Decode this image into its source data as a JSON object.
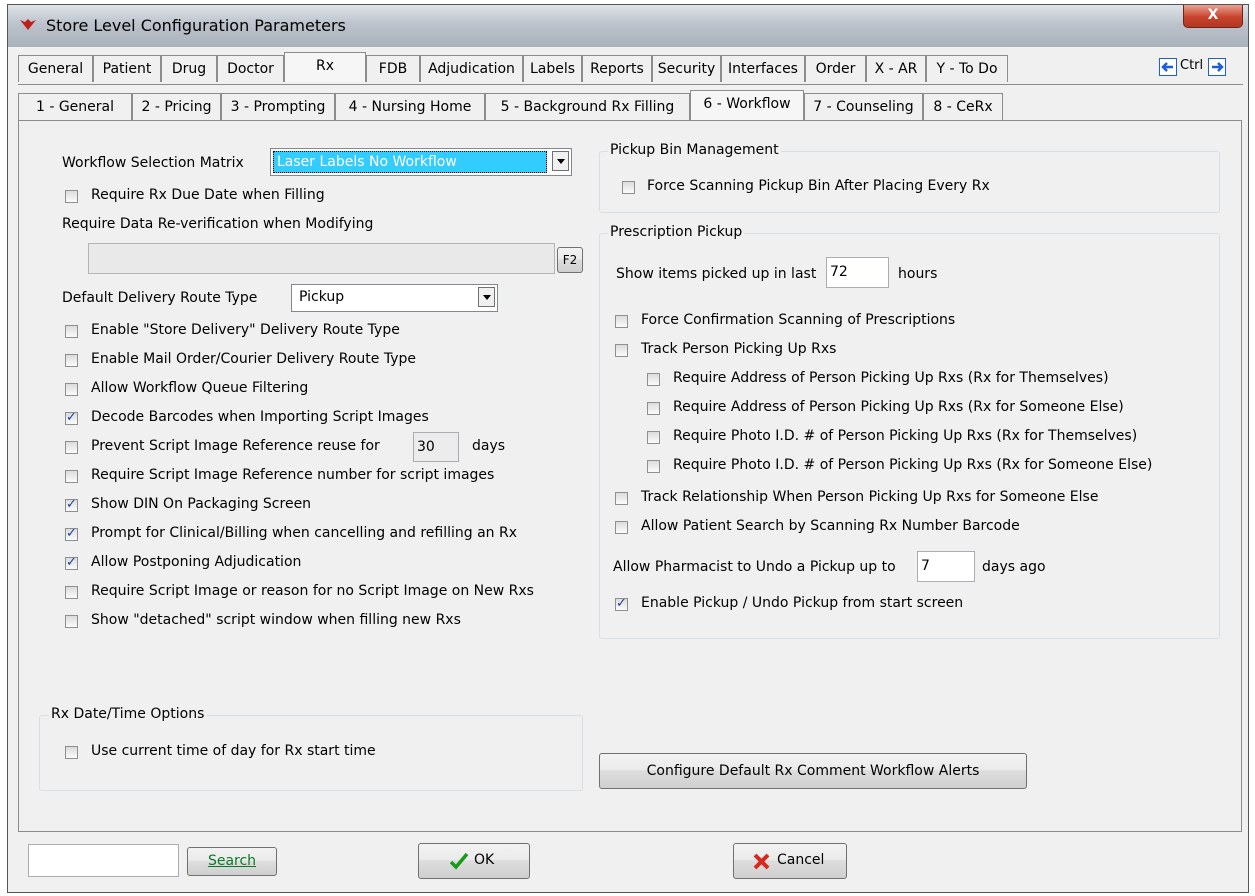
{
  "window": {
    "title": "Store Level Configuration Parameters",
    "close_label": "X"
  },
  "main_tabs": [
    "General",
    "Patient",
    "Drug",
    "Doctor",
    "Rx",
    "FDB",
    "Adjudication",
    "Labels",
    "Reports",
    "Security",
    "Interfaces",
    "Order",
    "X - AR",
    "Y - To Do"
  ],
  "ctrl_label": "Ctrl",
  "sub_tabs": [
    "1 - General",
    "2 - Pricing",
    "3 - Prompting",
    "4 - Nursing Home",
    "5 - Background Rx Filling",
    "6 - Workflow",
    "7 - Counseling",
    "8 - CeRx"
  ],
  "left": {
    "workflow_matrix_label": "Workflow Selection Matrix",
    "workflow_matrix_value": "Laser Labels No Workflow",
    "require_due_date": "Require Rx Due Date when Filling",
    "reverification_label": "Require Data Re-verification when Modifying",
    "f2_label": "F2",
    "delivery_route_label": "Default Delivery Route Type",
    "delivery_route_value": "Pickup",
    "options": [
      {
        "label": "Enable \"Store Delivery\" Delivery Route Type",
        "checked": false
      },
      {
        "label": "Enable Mail Order/Courier Delivery Route Type",
        "checked": false
      },
      {
        "label": "Allow Workflow Queue Filtering",
        "checked": false
      },
      {
        "label": "Decode Barcodes when Importing Script Images",
        "checked": true
      },
      {
        "label": "Prevent Script Image Reference reuse for",
        "checked": false
      },
      {
        "label": "Require Script Image Reference number for script images",
        "checked": false
      },
      {
        "label": "Show DIN On Packaging Screen",
        "checked": true
      },
      {
        "label": "Prompt for Clinical/Billing when cancelling and refilling an Rx",
        "checked": true
      },
      {
        "label": "Allow Postponing Adjudication",
        "checked": true
      },
      {
        "label": "Require Script Image or reason for no Script Image on New Rxs",
        "checked": false
      },
      {
        "label": "Show \"detached\" script window when filling new Rxs",
        "checked": false
      }
    ],
    "reuse_days_value": "30",
    "reuse_days_unit": "days",
    "date_group_title": "Rx Date/Time Options",
    "use_current_time": "Use current time of day for Rx start time"
  },
  "right": {
    "bin_group_title": "Pickup Bin Management",
    "force_scan_bin": "Force Scanning Pickup Bin After Placing Every Rx",
    "pickup_group_title": "Prescription Pickup",
    "show_items_label": "Show items picked up in last",
    "show_items_value": "72",
    "show_items_unit": "hours",
    "options": [
      {
        "label": "Force Confirmation Scanning of Prescriptions",
        "checked": false
      },
      {
        "label": "Track Person Picking Up Rxs",
        "checked": false
      }
    ],
    "sub_options": [
      {
        "label": "Require Address of Person Picking Up Rxs (Rx for Themselves)",
        "checked": false
      },
      {
        "label": "Require Address of Person Picking Up Rxs (Rx for Someone Else)",
        "checked": false
      },
      {
        "label": "Require Photo I.D. # of Person Picking Up Rxs (Rx for Themselves)",
        "checked": false
      },
      {
        "label": "Require Photo I.D. # of Person Picking Up Rxs (Rx for Someone Else)",
        "checked": false
      }
    ],
    "options2": [
      {
        "label": "Track Relationship When Person Picking Up Rxs for Someone Else",
        "checked": false
      },
      {
        "label": "Allow Patient Search by Scanning Rx Number Barcode",
        "checked": false
      }
    ],
    "undo_label": "Allow Pharmacist to Undo a Pickup up to",
    "undo_value": "7",
    "undo_unit": "days ago",
    "enable_undo": "Enable Pickup / Undo Pickup from start screen",
    "configure_button": "Configure Default Rx Comment Workflow Alerts"
  },
  "bottom": {
    "search_value": "",
    "search_button": "Search",
    "ok_button": "OK",
    "cancel_button": "Cancel"
  },
  "colors": {
    "selection_bg": "#33ccff",
    "checkmark": "#1d3f9a",
    "cancel_x": "#d42b1e",
    "ok_check": "#1a9a1a",
    "ctrl_arrow": "#1c5fd8"
  }
}
